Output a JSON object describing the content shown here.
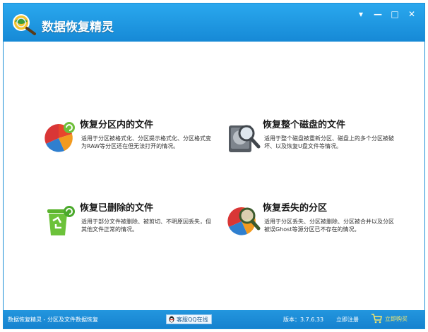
{
  "app": {
    "title": "数据恢复精灵"
  },
  "window_controls": {
    "menu": "▾",
    "minimize": "—",
    "maximize": "□",
    "close": "✕"
  },
  "cards": [
    {
      "title": "恢复分区内的文件",
      "description": "适用于分区被格式化、分区提示格式化、分区格式变为RAW等分区还在但无法打开的情况。"
    },
    {
      "title": "恢复整个磁盘的文件",
      "description": "适用于整个磁盘被重新分区、磁盘上的多个分区被破坏、以及恢复U盘文件等情况。"
    },
    {
      "title": "恢复已删除的文件",
      "description": "适用于部分文件被删除、被剪切、不明原因丢失，但其他文件正常的情况。"
    },
    {
      "title": "恢复丢失的分区",
      "description": "适用于分区丢失、分区被删除、分区被合并以及分区被误Ghost等源分区已不存在的情况。"
    }
  ],
  "statusbar": {
    "left_text": "数据恢复精灵 - 分区及文件数据恢复",
    "qq_button": "客服QQ在线",
    "version": "版本：3.7.6.33",
    "register": "立即注册",
    "buy": "立即购买"
  },
  "colors": {
    "titlebar": "#1e96e0",
    "statusbar": "#1d8ad6",
    "buy_text": "#f7e86a"
  },
  "icons": {
    "logo": "magnifier-globe-icon",
    "card1": "pie-chart-refresh-icon",
    "card2": "hard-disk-magnifier-icon",
    "card3": "recycle-bin-icon",
    "card4": "pie-chart-magnifier-icon",
    "qq": "qq-penguin-icon",
    "cart": "shopping-cart-icon"
  }
}
